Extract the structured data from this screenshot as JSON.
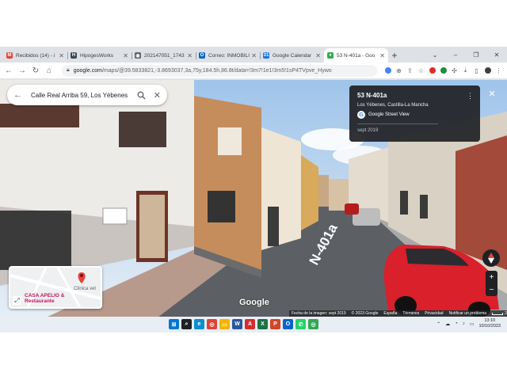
{
  "tabs": [
    {
      "title": "Recibidos (14) - i",
      "favicon": "gmail-icon",
      "color": "#ea4335",
      "glyph": "M",
      "active": false
    },
    {
      "title": "HipogesWorks",
      "favicon": "hipoges-icon",
      "color": "#37474f",
      "glyph": "H",
      "active": false
    },
    {
      "title": "202147051_1743",
      "favicon": "globe-icon",
      "color": "#5f6368",
      "glyph": "◉",
      "active": false
    },
    {
      "title": "Correo: INMOBILI",
      "favicon": "outlook-icon",
      "color": "#0a64c8",
      "glyph": "O",
      "active": false
    },
    {
      "title": "Google Calendar",
      "favicon": "calendar-icon",
      "color": "#1a73e8",
      "glyph": "31",
      "active": false
    },
    {
      "title": "53 N-401a - Goo",
      "favicon": "maps-icon",
      "color": "#34a853",
      "glyph": "♦",
      "active": true
    }
  ],
  "window_controls": {
    "minimize": "–",
    "maximize": "❐",
    "close": "✕",
    "dropdown": "⌄"
  },
  "toolbar": {
    "back": "←",
    "forward": "→",
    "reload": "↻",
    "home": "⌂",
    "url_host": "google.com",
    "url_path": "/maps/@39.5833821,-3.8693037,3a,75y,184.5h,86.8t/data=!3m7!1e1!3m5!1sP4TVpve_Hywo"
  },
  "searchbox": {
    "query": "Calle Real Arriba 59, Los Yébenes"
  },
  "infocard": {
    "title": "53 N-401a",
    "subtitle": "Los Yébenes, Castilla-La Mancha",
    "service": "Google Street View",
    "date": "sept 2019"
  },
  "scene": {
    "road_label": "N-401a"
  },
  "minimap": {
    "place_name": "CASA APELIO & Restaurante",
    "nearby": "Clínica vet"
  },
  "branding": {
    "logo": "Google"
  },
  "footer": {
    "capture": "Fecha de la imagen: sept 2019",
    "copyright": "© 2023 Google",
    "region": "España",
    "terms": "Términos",
    "privacy": "Privacidad",
    "report": "Notificar un problema",
    "scale": "2 m"
  },
  "zoom": {
    "in": "+",
    "out": "−"
  },
  "taskbar": {
    "icons": [
      {
        "name": "windows-start-icon",
        "color": "#0078d4",
        "glyph": "⊞"
      },
      {
        "name": "search-icon",
        "color": "#202124",
        "glyph": "⌕"
      },
      {
        "name": "edge-icon",
        "color": "#0c8fcf",
        "glyph": "e"
      },
      {
        "name": "chrome-icon",
        "color": "#db4437",
        "glyph": "◎"
      },
      {
        "name": "explorer-icon",
        "color": "#f4b400",
        "glyph": "▭"
      },
      {
        "name": "word-icon",
        "color": "#2b579a",
        "glyph": "W"
      },
      {
        "name": "acrobat-icon",
        "color": "#d32f2f",
        "glyph": "A"
      },
      {
        "name": "excel-icon",
        "color": "#1e7145",
        "glyph": "X"
      },
      {
        "name": "powerpoint-icon",
        "color": "#d24726",
        "glyph": "P"
      },
      {
        "name": "outlook-icon",
        "color": "#0a64c8",
        "glyph": "O"
      },
      {
        "name": "whatsapp-icon",
        "color": "#25d366",
        "glyph": "✆"
      },
      {
        "name": "chrome-alt-icon",
        "color": "#34a853",
        "glyph": "◎"
      }
    ],
    "time": "13:10",
    "date": "10/10/2023"
  }
}
